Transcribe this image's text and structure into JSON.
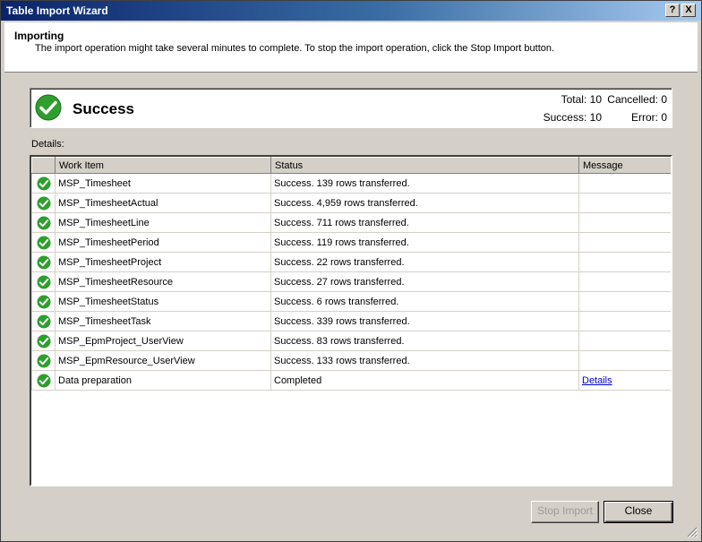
{
  "window": {
    "title": "Table Import Wizard",
    "help_glyph": "?",
    "close_glyph": "X"
  },
  "header": {
    "title": "Importing",
    "description": "The import operation might take several minutes to complete. To stop the import operation, click the Stop Import button."
  },
  "status": {
    "label": "Success",
    "total": "Total: 10",
    "cancelled": "Cancelled: 0",
    "success": "Success: 10",
    "error": "Error: 0"
  },
  "details_label": "Details:",
  "table": {
    "columns": [
      "",
      "Work Item",
      "Status",
      "Message"
    ],
    "rows": [
      {
        "work_item": "MSP_Timesheet",
        "status": "Success. 139 rows transferred.",
        "message": ""
      },
      {
        "work_item": "MSP_TimesheetActual",
        "status": "Success. 4,959 rows transferred.",
        "message": ""
      },
      {
        "work_item": "MSP_TimesheetLine",
        "status": "Success. 711 rows transferred.",
        "message": ""
      },
      {
        "work_item": "MSP_TimesheetPeriod",
        "status": "Success. 119 rows transferred.",
        "message": ""
      },
      {
        "work_item": "MSP_TimesheetProject",
        "status": "Success. 22 rows transferred.",
        "message": ""
      },
      {
        "work_item": "MSP_TimesheetResource",
        "status": "Success. 27 rows transferred.",
        "message": ""
      },
      {
        "work_item": "MSP_TimesheetStatus",
        "status": "Success. 6 rows transferred.",
        "message": ""
      },
      {
        "work_item": "MSP_TimesheetTask",
        "status": "Success. 339 rows transferred.",
        "message": ""
      },
      {
        "work_item": "MSP_EpmProject_UserView",
        "status": "Success. 83 rows transferred.",
        "message": ""
      },
      {
        "work_item": "MSP_EpmResource_UserView",
        "status": "Success. 133 rows transferred.",
        "message": ""
      },
      {
        "work_item": "Data preparation",
        "status": "Completed",
        "message": "Details"
      }
    ]
  },
  "buttons": {
    "stop_import": "Stop Import",
    "close": "Close"
  },
  "colors": {
    "success_green": "#2e9e2e",
    "title_blue": "#0a246a",
    "link": "#0000cc"
  },
  "icons": {
    "status": "success-check-icon"
  }
}
